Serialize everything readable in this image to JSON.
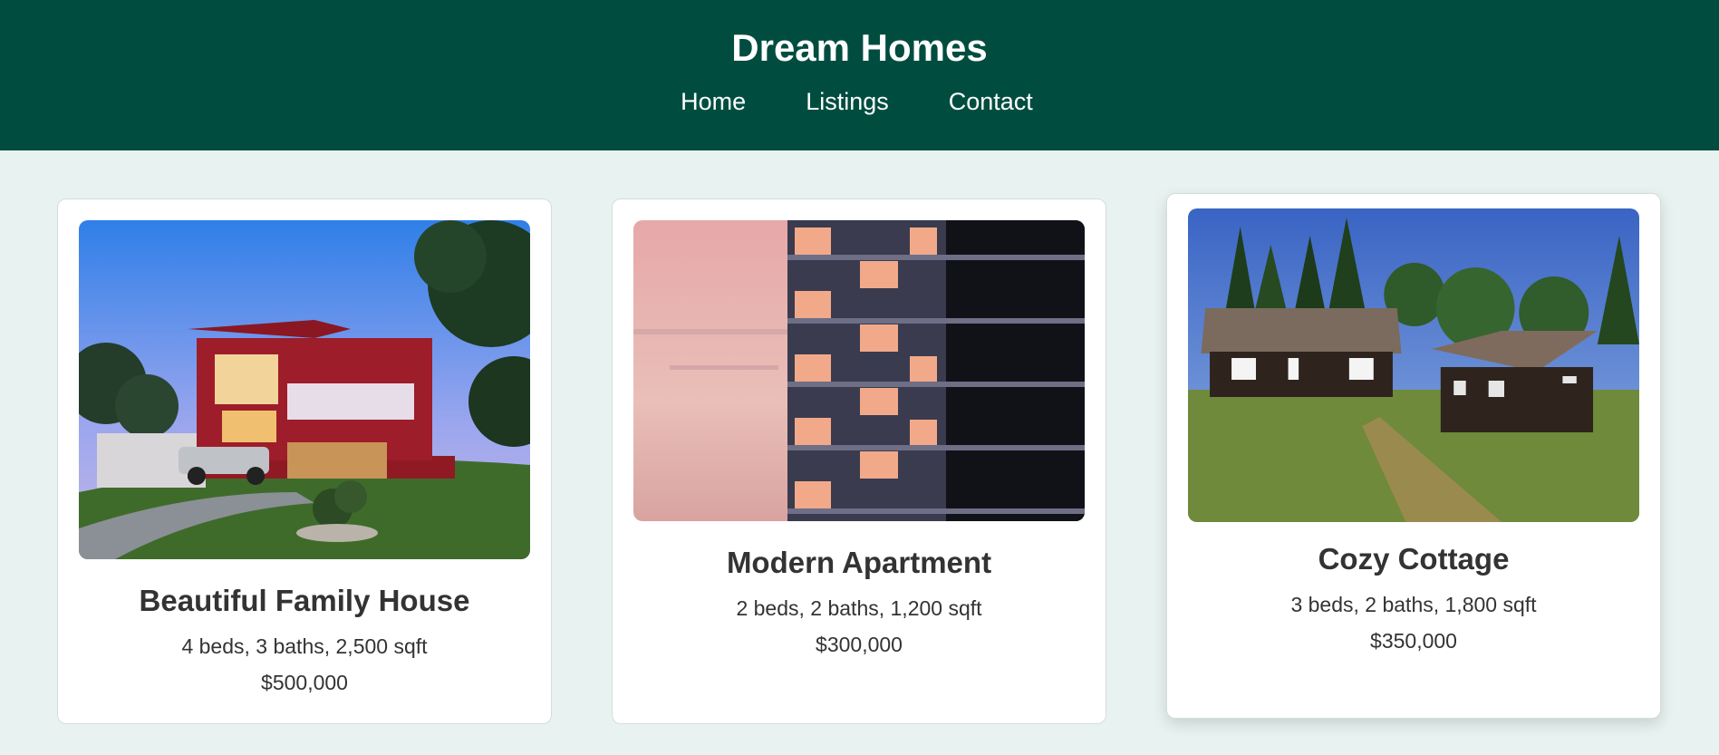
{
  "header": {
    "title": "Dream Homes",
    "nav": [
      "Home",
      "Listings",
      "Contact"
    ]
  },
  "colors": {
    "header_bg": "#004d40",
    "page_bg": "#e8f3f1",
    "card_bg": "#ffffff"
  },
  "listings": [
    {
      "title": "Beautiful Family House",
      "details": "4 beds, 3 baths, 2,500 sqft",
      "price": "$500,000",
      "image": "modern-house-photo"
    },
    {
      "title": "Modern Apartment",
      "details": "2 beds, 2 baths, 1,200 sqft",
      "price": "$300,000",
      "image": "apartment-building-photo"
    },
    {
      "title": "Cozy Cottage",
      "details": "3 beds, 2 baths, 1,800 sqft",
      "price": "$350,000",
      "image": "log-cottage-photo"
    }
  ]
}
